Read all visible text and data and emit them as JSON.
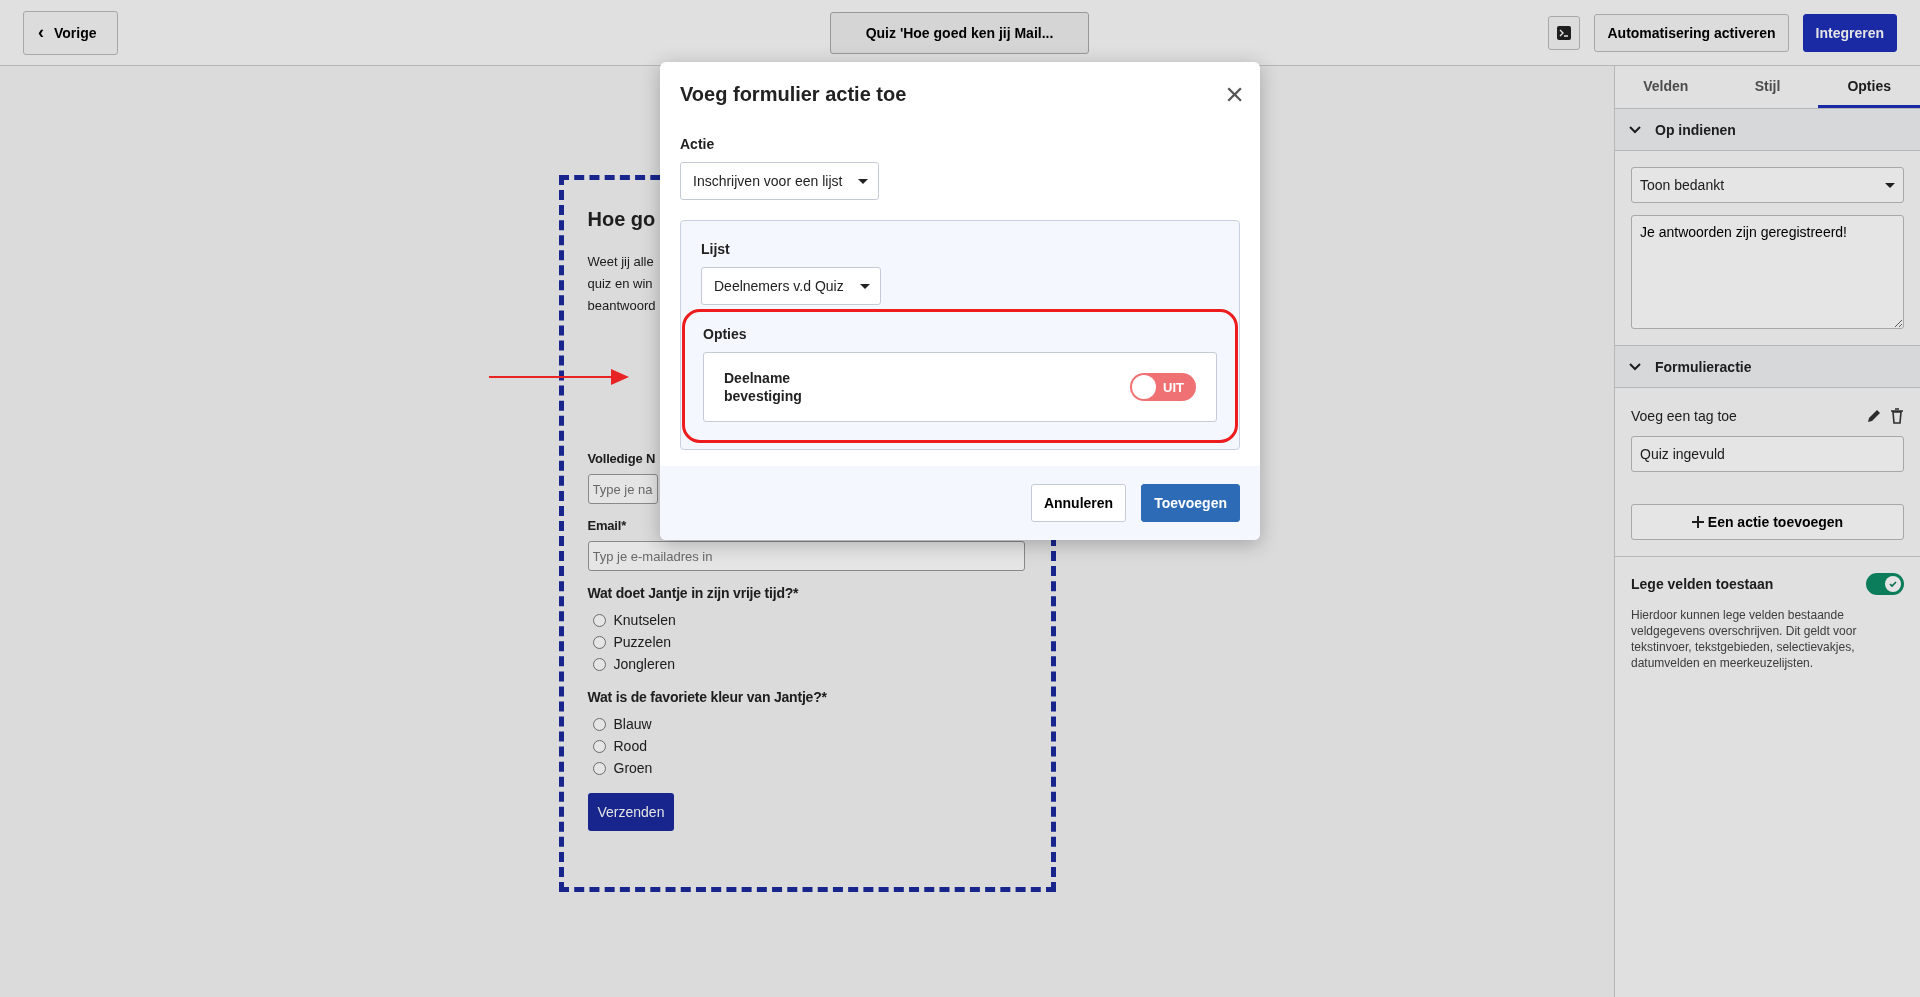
{
  "topbar": {
    "back": {
      "icon": "‹",
      "label": "Vorige"
    },
    "title": "Quiz 'Hoe goed ken jij Mail...",
    "actions": [
      {
        "kind": "icon"
      },
      {
        "kind": "text",
        "label": "Automatisering activeren",
        "primary": false
      },
      {
        "kind": "text",
        "label": "Integreren",
        "primary": true
      }
    ]
  },
  "form": {
    "title": "Hoe go",
    "intro": [
      "Weet jij alle",
      "quiz en win",
      "beantwoord"
    ],
    "fields": [
      {
        "label": "Volledige N",
        "placeholder": "Type je na",
        "wide": false
      },
      {
        "label": "Email*",
        "placeholder": "Typ je e-mailadres in",
        "wide": true
      }
    ],
    "questions": [
      {
        "label": "Wat doet Jantje in zijn vrije tijd?*",
        "options": [
          {
            "label": "Knutselen",
            "selected": false
          },
          {
            "label": "Puzzelen",
            "selected": false
          },
          {
            "label": "Jongleren",
            "selected": false
          }
        ]
      },
      {
        "label": "Wat is de favoriete kleur van Jantje?*",
        "options": [
          {
            "label": "Blauw",
            "selected": false
          },
          {
            "label": "Rood",
            "selected": false
          },
          {
            "label": "Groen",
            "selected": false
          }
        ]
      }
    ],
    "submit": "Verzenden"
  },
  "sidebar": {
    "tabs": [
      {
        "label": "Velden",
        "selected": false
      },
      {
        "label": "Stijl",
        "selected": false
      },
      {
        "label": "Opties",
        "selected": true
      }
    ],
    "sections": [
      {
        "title": "Op indienen",
        "expanded": true,
        "select": "Toon bedankt",
        "textarea": "Je antwoorden zijn geregistreerd!"
      },
      {
        "title": "Formulieractie",
        "expanded": true,
        "action_title": "Voeg een tag toe",
        "tag": "Quiz ingevuld",
        "add_button": "Een actie toevoegen"
      }
    ],
    "setting": {
      "label": "Lege velden toestaan",
      "on": true,
      "help": "Hierdoor kunnen lege velden bestaande veldgegevens overschrijven. Dit geldt voor tekstinvoer, tekstgebieden, selectievakjes, datumvelden en meerkeuzelijsten."
    }
  },
  "modal": {
    "title": "Voeg formulier actie toe",
    "close": "×",
    "action_label": "Actie",
    "action_value": "Inschrijven voor een lijst",
    "list_label": "Lijst",
    "list_value": "Deelnemers v.d Quiz",
    "options_label": "Opties",
    "option": {
      "label": "Deelname bevestiging",
      "on": false,
      "state_label": "UIT"
    },
    "buttons": [
      {
        "label": "Annuleren",
        "primary": false
      },
      {
        "label": "Toevoegen",
        "primary": true
      }
    ]
  }
}
